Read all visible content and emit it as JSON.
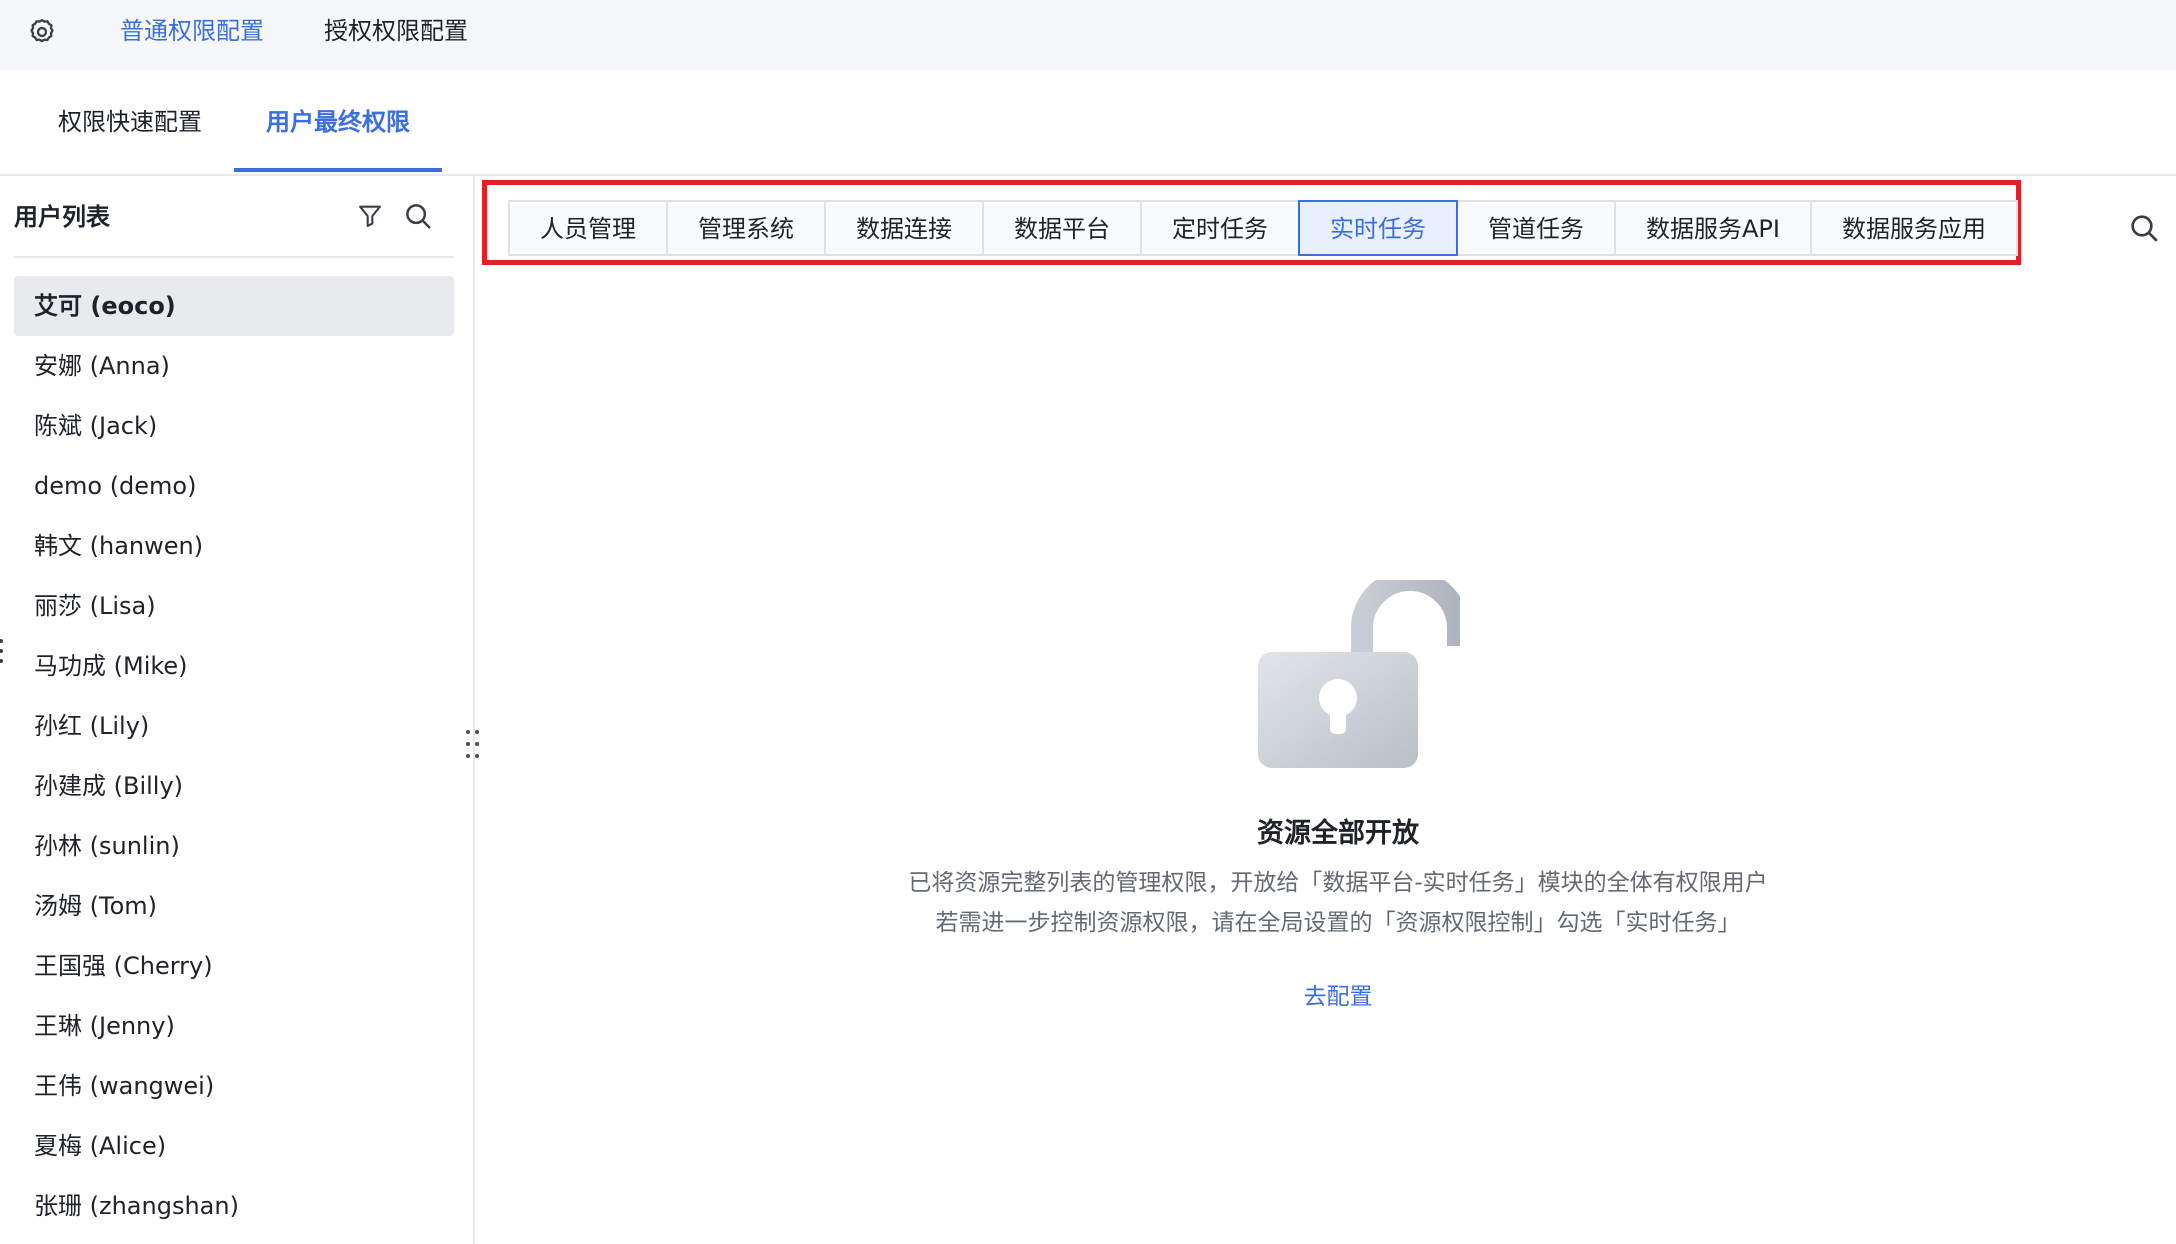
{
  "topbar": {
    "icon": "gear-icon",
    "tabs": [
      {
        "label": "普通权限配置",
        "active": true
      },
      {
        "label": "授权权限配置",
        "active": false
      }
    ]
  },
  "subtabs": [
    {
      "label": "权限快速配置",
      "active": false
    },
    {
      "label": "用户最终权限",
      "active": true
    }
  ],
  "sidebar": {
    "title": "用户列表",
    "filter_icon": "filter-icon",
    "search_icon": "search-icon",
    "users": [
      {
        "label": "艾可 (eoco)",
        "selected": true
      },
      {
        "label": "安娜 (Anna)"
      },
      {
        "label": "陈斌 (Jack)"
      },
      {
        "label": "demo (demo)"
      },
      {
        "label": "韩文 (hanwen)"
      },
      {
        "label": "丽莎 (Lisa)"
      },
      {
        "label": "马功成 (Mike)"
      },
      {
        "label": "孙红 (Lily)"
      },
      {
        "label": "孙建成 (Billy)"
      },
      {
        "label": "孙林 (sunlin)"
      },
      {
        "label": "汤姆 (Tom)"
      },
      {
        "label": "王国强 (Cherry)"
      },
      {
        "label": "王琳 (Jenny)"
      },
      {
        "label": "王伟 (wangwei)"
      },
      {
        "label": "夏梅 (Alice)"
      },
      {
        "label": "张珊 (zhangshan)"
      }
    ]
  },
  "modules": {
    "tabs": [
      "人员管理",
      "管理系统",
      "数据连接",
      "数据平台",
      "定时任务",
      "实时任务",
      "管道任务",
      "数据服务API",
      "数据服务应用"
    ],
    "active": "实时任务",
    "search_icon": "search-icon"
  },
  "empty_state": {
    "icon": "unlocked-padlock-icon",
    "title": "资源全部开放",
    "desc_line1": "已将资源完整列表的管理权限，开放给「数据平台-实时任务」模块的全体有权限用户",
    "desc_line2": "若需进一步控制资源权限，请在全局设置的「资源权限控制」勾选「实时任务」",
    "link": "去配置"
  },
  "colors": {
    "accent": "#3b6fe0",
    "highlight_box": "#e32025",
    "selected_row": "#e9eaee"
  }
}
